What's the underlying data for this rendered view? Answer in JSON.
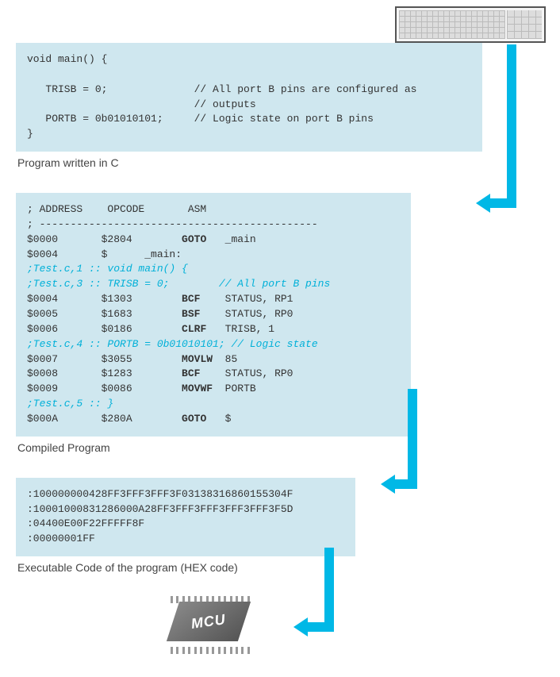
{
  "keyboard": {
    "name": "keyboard-icon"
  },
  "stage1": {
    "code": "void main() {\n\n   TRISB = 0;              // All port B pins are configured as\n                           // outputs\n   PORTB = 0b01010101;     // Logic state on port B pins\n}",
    "caption": "Program written in C"
  },
  "stage2": {
    "lines": [
      {
        "t": "; ADDRESS    OPCODE       ASM"
      },
      {
        "t": "; ---------------------------------------------"
      },
      {
        "plain": "$0000       $2804        ",
        "bold": "GOTO",
        "rest": "   _main"
      },
      {
        "plain": "$0004       $      _main:"
      },
      {
        "blue": ";Test.c,1 :: void main() {"
      },
      {
        "blue": ";Test.c,3 :: TRISB = 0;        // All port B pins"
      },
      {
        "plain": "$0004       $1303        ",
        "bold": "BCF",
        "rest": "    STATUS, RP1"
      },
      {
        "plain": "$0005       $1683        ",
        "bold": "BSF",
        "rest": "    STATUS, RP0"
      },
      {
        "plain": "$0006       $0186        ",
        "bold": "CLRF",
        "rest": "   TRISB, 1"
      },
      {
        "blue": ";Test.c,4 :: PORTB = 0b01010101; // Logic state"
      },
      {
        "plain": "$0007       $3055        ",
        "bold": "MOVLW",
        "rest": "  85"
      },
      {
        "plain": "$0008       $1283        ",
        "bold": "BCF",
        "rest": "    STATUS, RP0"
      },
      {
        "plain": "$0009       $0086        ",
        "bold": "MOVWF",
        "rest": "  PORTB"
      },
      {
        "blue": ";Test.c,5 :: }"
      },
      {
        "plain": "$000A       $280A        ",
        "bold": "GOTO",
        "rest": "   $"
      }
    ],
    "caption": "Compiled Program"
  },
  "stage3": {
    "code": ":100000000428FF3FFF3FFF3F03138316860155304F\n:10001000831286000A28FF3FFF3FFF3FFF3FFF3F5D\n:04400E00F22FFFFF8F\n:00000001FF",
    "caption": "Executable Code of the program (HEX code)"
  },
  "mcu": {
    "label": "MCU"
  }
}
